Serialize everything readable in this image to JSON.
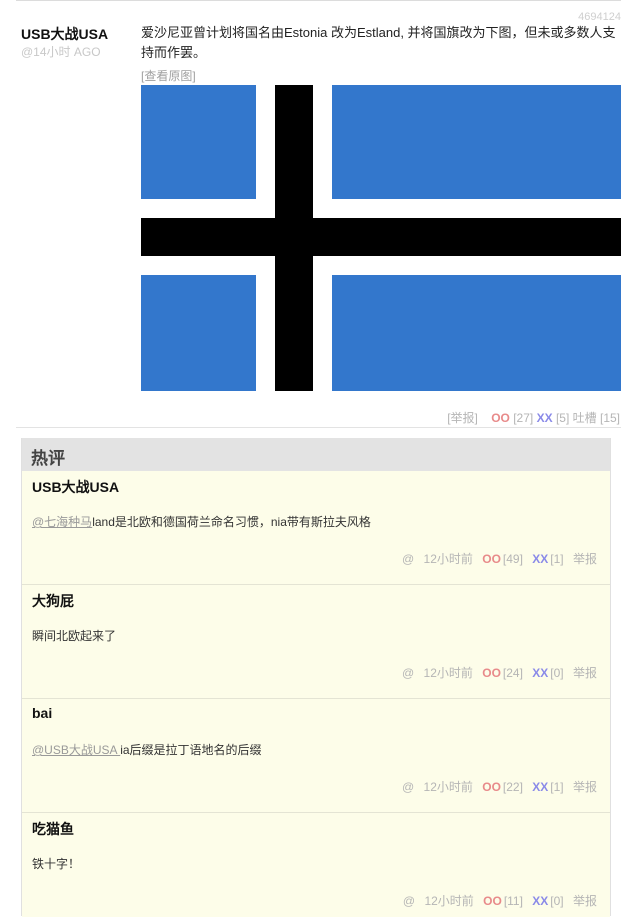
{
  "post": {
    "id": "4694124",
    "author": "USB大战USA",
    "time": "@14小时 AGO",
    "text": "爱沙尼亚曾计划将国名由Estonia 改为Estland, 并将国旗改为下图，但未或多数人支持而作罢。",
    "view_original": "[查看原图]",
    "flag_colors": {
      "field": "#3377cc",
      "cross": "#000000",
      "fimbriation": "#ffffff"
    },
    "actions": {
      "report": "[举报]",
      "oo_label": "OO",
      "oo_count": "[27]",
      "xx_label": "XX",
      "xx_count": "[5]",
      "tucao_label": "吐槽",
      "tucao_count": "[15]"
    }
  },
  "hot_comments": {
    "title": "热评",
    "items": [
      {
        "author": "USB大战USA",
        "mention": "@七海种马",
        "text": "land是北欧和德国荷兰命名习惯，nia带有斯拉夫风格",
        "at": "@",
        "time": "12小时前",
        "oo_label": "OO",
        "oo_count": "[49]",
        "xx_label": "XX",
        "xx_count": "[1]",
        "report": "举报"
      },
      {
        "author": "大狗屁",
        "mention": "",
        "text": "瞬间北欧起来了",
        "at": "@",
        "time": "12小时前",
        "oo_label": "OO",
        "oo_count": "[24]",
        "xx_label": "XX",
        "xx_count": "[0]",
        "report": "举报"
      },
      {
        "author": "bai",
        "mention": "@USB大战USA ",
        "text": "ia后缀是拉丁语地名的后缀",
        "at": "@",
        "time": "12小时前",
        "oo_label": "OO",
        "oo_count": "[22]",
        "xx_label": "XX",
        "xx_count": "[1]",
        "report": "举报"
      },
      {
        "author": "吃猫鱼",
        "mention": "",
        "text": "铁十字！",
        "at": "@",
        "time": "12小时前",
        "oo_label": "OO",
        "oo_count": "[11]",
        "xx_label": "XX",
        "xx_count": "[0]",
        "report": "举报"
      }
    ]
  }
}
